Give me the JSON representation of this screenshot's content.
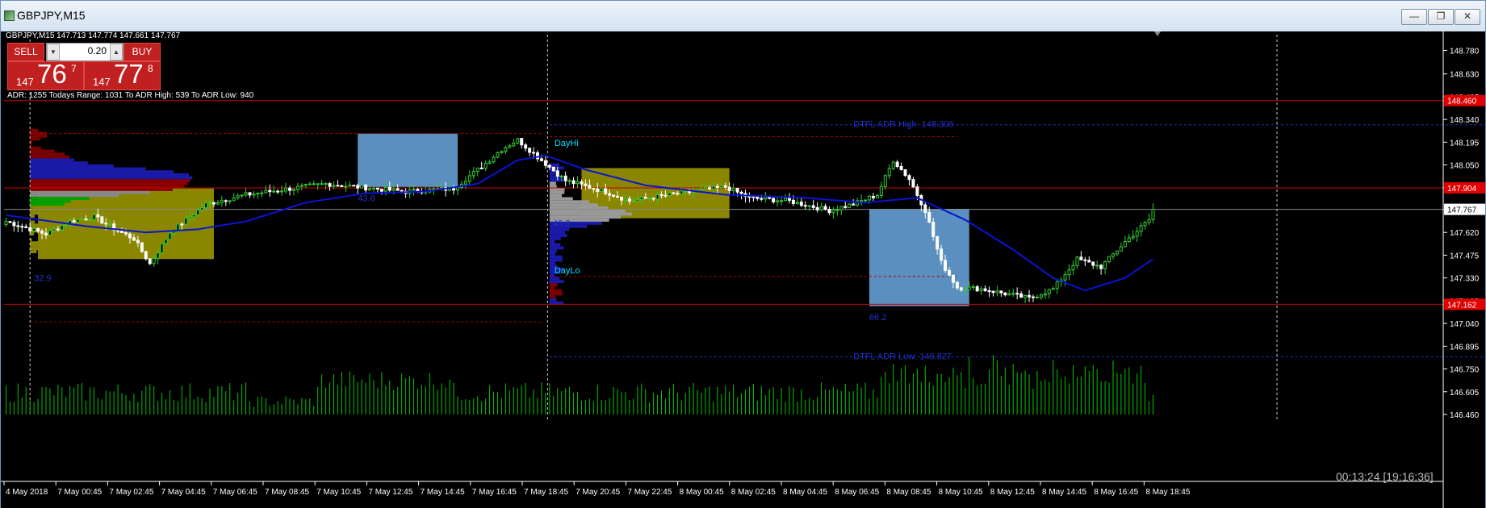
{
  "window": {
    "title": "GBPJPY,M15",
    "buttons": [
      "—",
      "❐",
      "✕"
    ]
  },
  "trade_panel": {
    "symbol_line": "GBPJPY,M15  147.713 147.774 147.661 147.767",
    "sell_label": "SELL",
    "buy_label": "BUY",
    "lot_value": "0.20",
    "sell_small": "147",
    "sell_big": "76",
    "sell_sup": "7",
    "buy_small": "147",
    "buy_big": "77",
    "buy_sup": "8",
    "adr_line": "ADR: 1255  Todays Range: 1031  To ADR High: 539  To ADR Low: 940"
  },
  "timer": "00:13:24 [19:16:36]",
  "colors": {
    "background": "#000000",
    "bull_candle": "#32cd32",
    "bear_candle": "#ffffff",
    "volume": "#00c800",
    "moving_average": "#0a14d2",
    "red_level": "#cc0000",
    "adr_line": "#2030c8",
    "steelblue_box": "#5b8fbf",
    "olive_box": "#8a8600"
  },
  "chart_data": {
    "type": "candlestick",
    "symbol": "GBPJPY",
    "timeframe": "M15",
    "ylim": [
      146.46,
      148.88
    ],
    "y_ticks": [
      "148.780",
      "148.630",
      "148.485",
      "148.340",
      "148.195",
      "148.050",
      "147.905",
      "147.767",
      "147.620",
      "147.475",
      "147.330",
      "147.185",
      "147.040",
      "146.895",
      "146.750",
      "146.605",
      "146.460"
    ],
    "x_ticks": [
      "4 May 2018",
      "7 May 00:45",
      "7 May 02:45",
      "7 May 04:45",
      "7 May 06:45",
      "7 May 08:45",
      "7 May 10:45",
      "7 May 12:45",
      "7 May 14:45",
      "7 May 16:45",
      "7 May 18:45",
      "7 May 20:45",
      "7 May 22:45",
      "8 May 00:45",
      "8 May 02:45",
      "8 May 04:45",
      "8 May 06:45",
      "8 May 08:45",
      "8 May 10:45",
      "8 May 12:45",
      "8 May 14:45",
      "8 May 16:45",
      "8 May 18:45"
    ],
    "current_price": "147.767",
    "red_price_labels": [
      "148.460",
      "147.904",
      "147.162"
    ],
    "horizontal_red_levels": [
      148.46,
      147.904,
      147.162
    ],
    "adr_high_label": "DTFL ADR High: 148.306",
    "adr_low_label": "DTFL ADR Low: 146.827",
    "adr_high": 148.306,
    "adr_low": 146.827,
    "day_labels": [
      "DayHi",
      "DayLo"
    ],
    "box_labels": [
      "32.9",
      "43.6",
      "40.6",
      "66.2"
    ],
    "close_anchors": [
      {
        "i": 0,
        "v": 147.69
      },
      {
        "i": 10,
        "v": 147.61
      },
      {
        "i": 16,
        "v": 147.69
      },
      {
        "i": 22,
        "v": 147.72
      },
      {
        "i": 28,
        "v": 147.63
      },
      {
        "i": 32,
        "v": 147.58
      },
      {
        "i": 36,
        "v": 147.42
      },
      {
        "i": 41,
        "v": 147.62
      },
      {
        "i": 50,
        "v": 147.8
      },
      {
        "i": 60,
        "v": 147.86
      },
      {
        "i": 80,
        "v": 147.93
      },
      {
        "i": 100,
        "v": 147.88
      },
      {
        "i": 112,
        "v": 147.9
      },
      {
        "i": 120,
        "v": 148.06
      },
      {
        "i": 124,
        "v": 148.15
      },
      {
        "i": 128,
        "v": 148.21
      },
      {
        "i": 134,
        "v": 148.08
      },
      {
        "i": 140,
        "v": 147.95
      },
      {
        "i": 150,
        "v": 147.88
      },
      {
        "i": 156,
        "v": 147.82
      },
      {
        "i": 166,
        "v": 147.86
      },
      {
        "i": 172,
        "v": 147.88
      },
      {
        "i": 180,
        "v": 147.91
      },
      {
        "i": 186,
        "v": 147.84
      },
      {
        "i": 196,
        "v": 147.82
      },
      {
        "i": 206,
        "v": 147.76
      },
      {
        "i": 212,
        "v": 147.8
      },
      {
        "i": 218,
        "v": 147.86
      },
      {
        "i": 222,
        "v": 148.08
      },
      {
        "i": 226,
        "v": 147.96
      },
      {
        "i": 230,
        "v": 147.76
      },
      {
        "i": 234,
        "v": 147.43
      },
      {
        "i": 238,
        "v": 147.27
      },
      {
        "i": 244,
        "v": 147.26
      },
      {
        "i": 250,
        "v": 147.23
      },
      {
        "i": 256,
        "v": 147.2
      },
      {
        "i": 262,
        "v": 147.26
      },
      {
        "i": 268,
        "v": 147.45
      },
      {
        "i": 274,
        "v": 147.4
      },
      {
        "i": 280,
        "v": 147.56
      },
      {
        "i": 286,
        "v": 147.7
      },
      {
        "i": 287,
        "v": 147.767
      }
    ],
    "moving_average": [
      {
        "i": 0,
        "v": 147.73
      },
      {
        "i": 20,
        "v": 147.66
      },
      {
        "i": 35,
        "v": 147.62
      },
      {
        "i": 48,
        "v": 147.64
      },
      {
        "i": 60,
        "v": 147.69
      },
      {
        "i": 75,
        "v": 147.81
      },
      {
        "i": 90,
        "v": 147.87
      },
      {
        "i": 105,
        "v": 147.88
      },
      {
        "i": 118,
        "v": 147.93
      },
      {
        "i": 128,
        "v": 148.08
      },
      {
        "i": 135,
        "v": 148.11
      },
      {
        "i": 145,
        "v": 148.02
      },
      {
        "i": 160,
        "v": 147.92
      },
      {
        "i": 180,
        "v": 147.86
      },
      {
        "i": 200,
        "v": 147.84
      },
      {
        "i": 215,
        "v": 147.81
      },
      {
        "i": 228,
        "v": 147.84
      },
      {
        "i": 240,
        "v": 147.7
      },
      {
        "i": 252,
        "v": 147.51
      },
      {
        "i": 262,
        "v": 147.33
      },
      {
        "i": 270,
        "v": 147.25
      },
      {
        "i": 280,
        "v": 147.33
      },
      {
        "i": 287,
        "v": 147.45
      }
    ]
  }
}
